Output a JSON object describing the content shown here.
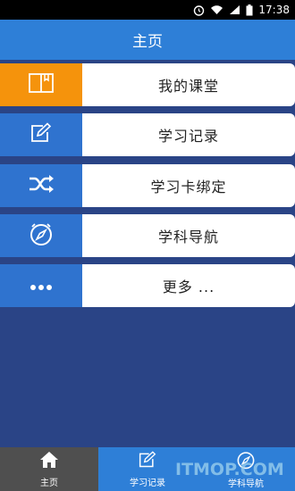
{
  "status_bar": {
    "time": "17:38",
    "icons": [
      "alarm-icon",
      "wifi-icon",
      "signal-icon",
      "battery-icon"
    ]
  },
  "app_bar": {
    "title": "主页"
  },
  "menu": {
    "items": [
      {
        "label": "我的课堂",
        "icon": "book-icon",
        "accent": "#f5930c"
      },
      {
        "label": "学习记录",
        "icon": "edit-icon",
        "accent": "#2f73cf"
      },
      {
        "label": "学习卡绑定",
        "icon": "shuffle-icon",
        "accent": "#2f73cf"
      },
      {
        "label": "学科导航",
        "icon": "compass-icon",
        "accent": "#2f73cf"
      },
      {
        "label": "更多 ...",
        "icon": "more-icon",
        "accent": "#2f73cf"
      }
    ]
  },
  "bottom_nav": {
    "items": [
      {
        "label": "主页",
        "icon": "home-icon",
        "active": true
      },
      {
        "label": "学习记录",
        "icon": "edit-icon",
        "active": false
      },
      {
        "label": "学科导航",
        "icon": "compass-icon",
        "active": false
      }
    ]
  },
  "watermark": "ITMOP.COM",
  "colors": {
    "background": "#2a4486",
    "app_bar": "#2e7fd7",
    "accent_orange": "#f5930c",
    "icon_blue": "#2f73cf",
    "nav_active": "#4f4f4f"
  }
}
